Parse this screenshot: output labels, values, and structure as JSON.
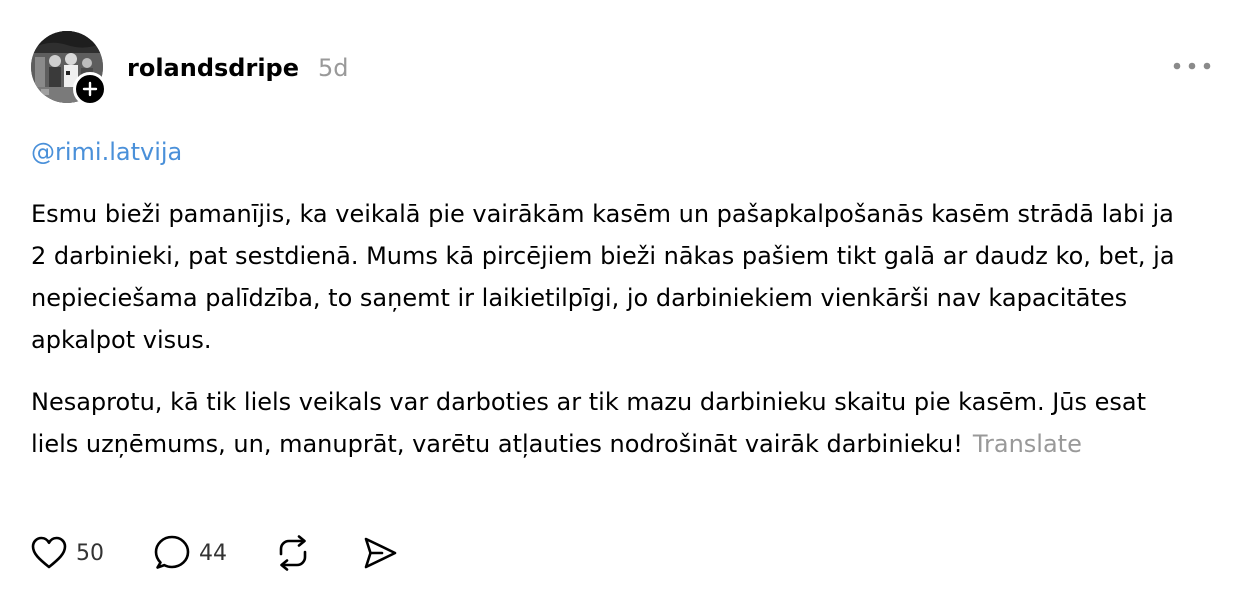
{
  "post": {
    "username": "rolandsdripe",
    "timestamp": "5d",
    "mention": "@rimi.latvija",
    "paragraph_1": "Esmu bieži pamanījis, ka veikalā pie vairākām kasēm un pašapkalpošanās kasēm strādā labi ja 2 darbinieki, pat sestdienā. Mums kā pircējiem bieži nākas pašiem tikt galā ar daudz ko, bet, ja nepieciešama palīdzība, to saņemt ir laikietilpīgi, jo darbiniekiem vienkārši nav kapacitātes apkalpot visus.",
    "paragraph_2": "Nesaprotu, kā tik liels veikals var darboties ar tik mazu darbinieku skaitu pie kasēm. Jūs esat liels uzņēmums, un, manuprāt, varētu atļauties nodrošināt vairāk darbinieku!",
    "translate_label": "Translate"
  },
  "actions": {
    "likes": "50",
    "replies": "44"
  },
  "icons": {
    "follow": "plus-icon",
    "more": "more-dots-icon",
    "like": "heart-icon",
    "reply": "comment-bubble-icon",
    "repost": "repost-icon",
    "share": "send-icon"
  },
  "colors": {
    "mention": "#4a90d9",
    "muted": "#999999"
  }
}
